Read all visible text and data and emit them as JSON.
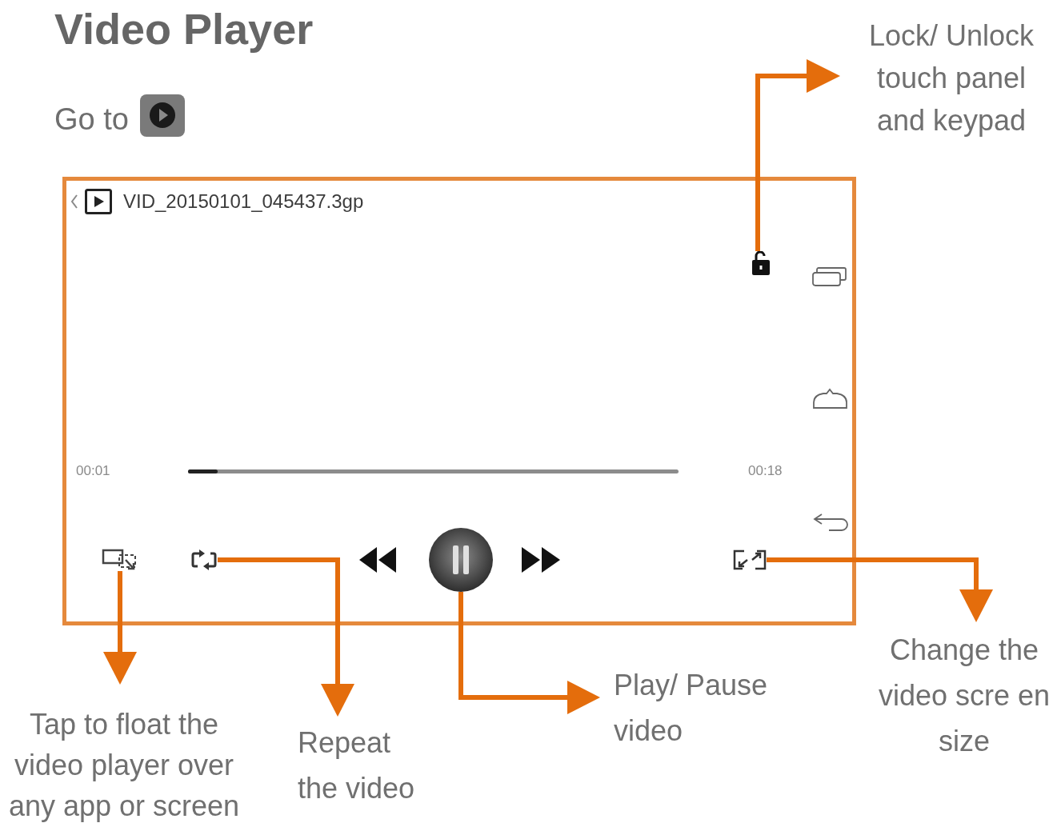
{
  "title": "Video Player",
  "instruction": {
    "text": "Go to"
  },
  "player": {
    "file_name": "VID_20150101_045437.3gp",
    "locked": false,
    "elapsed": "00:01",
    "progress": {
      "level": 0.06
    },
    "duration": "00:18",
    "playing": true
  },
  "callouts": [
    {
      "text": "Lock/ Unlock\ntouch panel\nand keypad"
    },
    {
      "text": "Tap to float the\nvideo player over\nany app or screen"
    },
    {
      "text": "Repeat\nthe video"
    },
    {
      "text": "Play/ Pause\nvideo"
    },
    {
      "text": "Change the\nvideo scre en\nsize"
    }
  ]
}
